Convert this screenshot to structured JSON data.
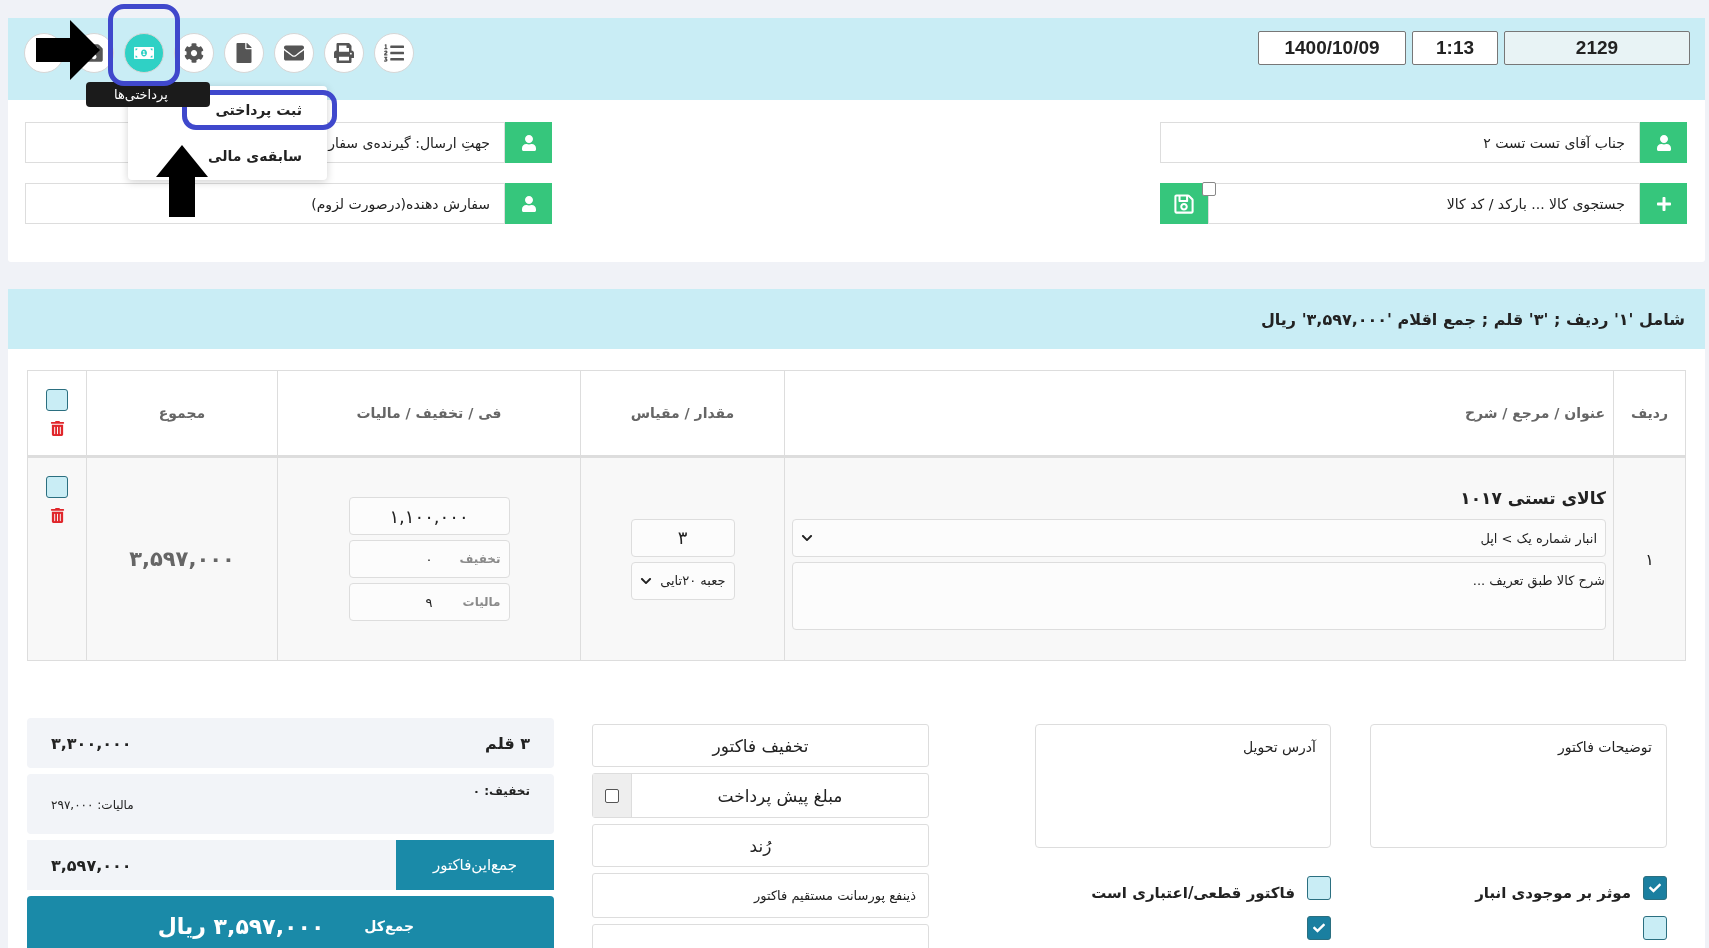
{
  "toolbar": {
    "buttons": [
      {
        "kind": "blank",
        "selected": false
      },
      {
        "kind": "save",
        "selected": false
      },
      {
        "kind": "payments",
        "selected": true
      },
      {
        "kind": "settings",
        "selected": false
      },
      {
        "kind": "document",
        "selected": false
      },
      {
        "kind": "mail",
        "selected": false
      },
      {
        "kind": "print",
        "selected": false
      },
      {
        "kind": "list",
        "selected": false
      }
    ],
    "tooltip": "پرداختی‌ها",
    "menu": [
      {
        "label": "ثبت پرداختی",
        "selected": true
      },
      {
        "label": "سابقه‌ی مالی",
        "selected": false
      }
    ]
  },
  "header": {
    "date": "1400/10/09",
    "time": "1:13",
    "number": "2129"
  },
  "customer_fields": [
    {
      "kind": "user",
      "value": "جناب آقای تست تست ۲"
    },
    {
      "kind": "search",
      "placeholder": "جستجوی کالا ... بارکد / کد کالا",
      "checked": false
    }
  ],
  "order_fields": [
    {
      "kind": "user",
      "placeholder": "جهتِ ارسال: گیرنده‌ی سفار"
    },
    {
      "kind": "user",
      "placeholder": "سفارش دهنده(درصورت لزوم)"
    }
  ],
  "summary": "شامل '۱' ردیف ; '۳' قلم ; جمع اقلام '۳,۵۹۷,۰۰۰' ریال",
  "table": {
    "columns": [
      "ردیف",
      "عنوان / مرجع / شرح",
      "مقدار / مقیاس",
      "فی / تخفیف / مالیات",
      "مجموع"
    ],
    "checked": false,
    "rows": [
      {
        "index": "۱",
        "title": "کالای تستی ۱۰۱۷",
        "warehouse": "انبار شماره یک > اپل",
        "description_placeholder": "شرح کالا طبق تعریف ...",
        "quantity": "۳",
        "unit": "جعبه ۲۰تایی",
        "price": "۱,۱۰۰,۰۰۰",
        "discount_label": "تخفیف",
        "discount": "۰",
        "tax_label": "مالیات",
        "tax": "۹",
        "total": "۳,۵۹۷,۰۰۰",
        "checked": false
      }
    ]
  },
  "totals": {
    "items": "۳ قلم",
    "subtotal": "۳,۳۰۰,۰۰۰",
    "discount": "تخفیف: ۰",
    "tax": "مالیات: ۲۹۷,۰۰۰",
    "invoice_total_label": "جمع‌این‌فاکتور",
    "invoice_total": "۳,۵۹۷,۰۰۰",
    "grand_total_label": "جمع‌کل",
    "grand_total": "۳,۵۹۷,۰۰۰ ریال"
  },
  "options": [
    {
      "kind": "button",
      "label": "تخفیف فاکتور"
    },
    {
      "kind": "check",
      "label": "مبلغ پیش پرداخت",
      "checked": false
    },
    {
      "kind": "button",
      "label": "رُند"
    },
    {
      "kind": "field",
      "label": "ذینفع پورسانت مستقیم فاکتور"
    },
    {
      "kind": "field"
    }
  ],
  "notes": [
    {
      "placeholder": "توضیحات فاکتور",
      "flags": [
        {
          "label": "موثر بر موجودی انبار",
          "checked": true
        },
        {
          "checked": false
        }
      ]
    },
    {
      "placeholder": "آدرس تحویل",
      "flags": [
        {
          "label": "فاکتور قطعی/اعتباری است",
          "checked": false
        },
        {
          "checked": true
        }
      ]
    }
  ]
}
